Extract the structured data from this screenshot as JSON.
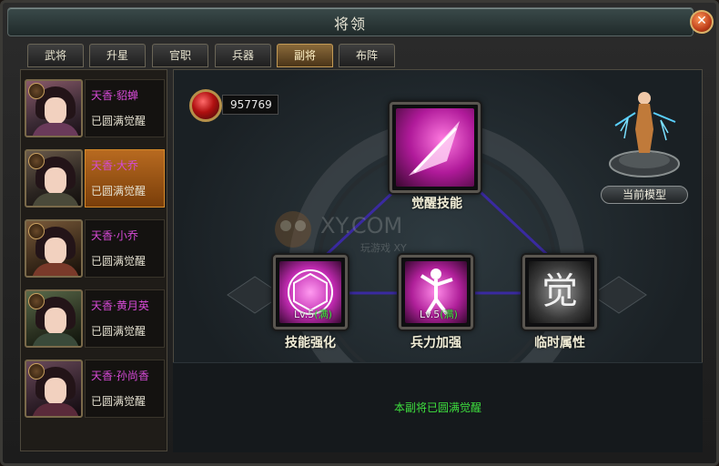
{
  "window": {
    "title": "将领",
    "close_icon": "close-icon"
  },
  "tabs": [
    {
      "label": "武将",
      "active": false
    },
    {
      "label": "升星",
      "active": false
    },
    {
      "label": "官职",
      "active": false
    },
    {
      "label": "兵器",
      "active": false
    },
    {
      "label": "副将",
      "active": true
    },
    {
      "label": "布阵",
      "active": false
    }
  ],
  "generals": [
    {
      "name": "天香·貂蝉",
      "status": "已圆满觉醒",
      "selected": false
    },
    {
      "name": "天香·大乔",
      "status": "已圆满觉醒",
      "selected": true
    },
    {
      "name": "天香·小乔",
      "status": "已圆满觉醒",
      "selected": false
    },
    {
      "name": "天香·黄月英",
      "status": "已圆满觉醒",
      "selected": false
    },
    {
      "name": "天香·孙尚香",
      "status": "已圆满觉醒",
      "selected": false
    }
  ],
  "currency": {
    "amount": "957769",
    "icon": "red-gem-icon"
  },
  "skills": {
    "awaken": {
      "label": "觉醒技能",
      "icon": "blade-icon"
    },
    "skill_boost": {
      "label": "技能强化",
      "level": "Lv.5",
      "max": "(满)",
      "icon": "hexagon-orb-icon"
    },
    "troop_boost": {
      "label": "兵力加强",
      "level": "Lv.5",
      "max": "(满)",
      "icon": "warrior-figure-icon"
    },
    "temp_attr": {
      "label": "临时属性",
      "glyph": "觉",
      "icon": "awaken-glyph-icon"
    }
  },
  "model": {
    "button_label": "当前模型"
  },
  "watermark": {
    "text": "XY.COM",
    "sub": "玩游戏 XY"
  },
  "footer": {
    "message": "本副将已圆满觉醒"
  },
  "colors": {
    "name_purple": "#d64ad6",
    "status_green": "#3ee03e",
    "selected_orange": "#b86a20"
  }
}
